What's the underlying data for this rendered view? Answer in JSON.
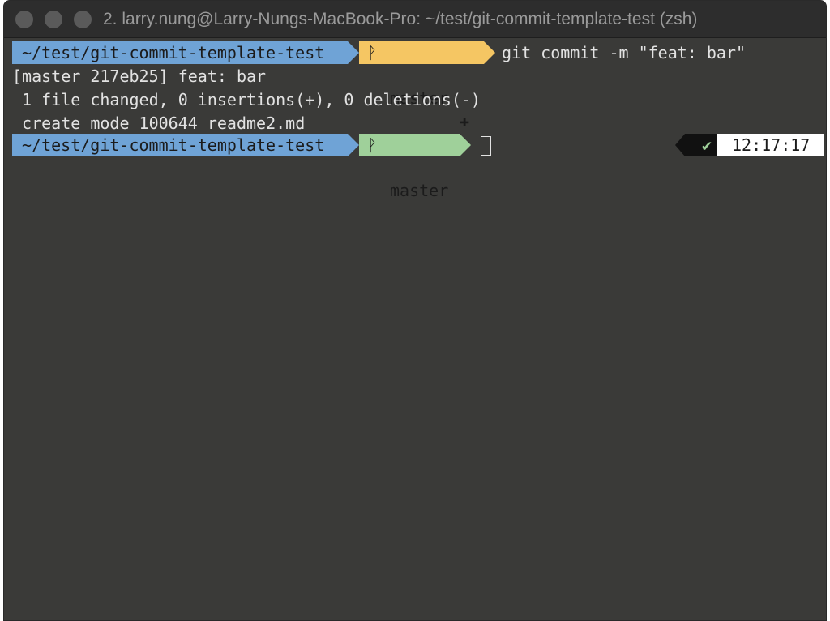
{
  "window": {
    "title": "2. larry.nung@Larry-Nungs-MacBook-Pro: ~/test/git-commit-template-test (zsh)"
  },
  "colors": {
    "dir_segment": "#6fa3d6",
    "git_dirty_segment": "#f5c663",
    "git_clean_segment": "#9fd09a",
    "status_ok": "#9fd09a",
    "terminal_bg": "#3a3a38"
  },
  "prompt1": {
    "dir": "~/test/git-commit-template-test",
    "branch_icon": "git-branch-icon",
    "branch": "master",
    "dirty_marker": "✚",
    "command": "git commit -m \"feat: bar\""
  },
  "output": {
    "line1": "[master 217eb25] feat: bar",
    "line2": " 1 file changed, 0 insertions(+), 0 deletions(-)",
    "line3": " create mode 100644 readme2.md"
  },
  "prompt2": {
    "dir": "~/test/git-commit-template-test",
    "branch": "master",
    "status_icon": "✔",
    "time": "12:17:17"
  }
}
